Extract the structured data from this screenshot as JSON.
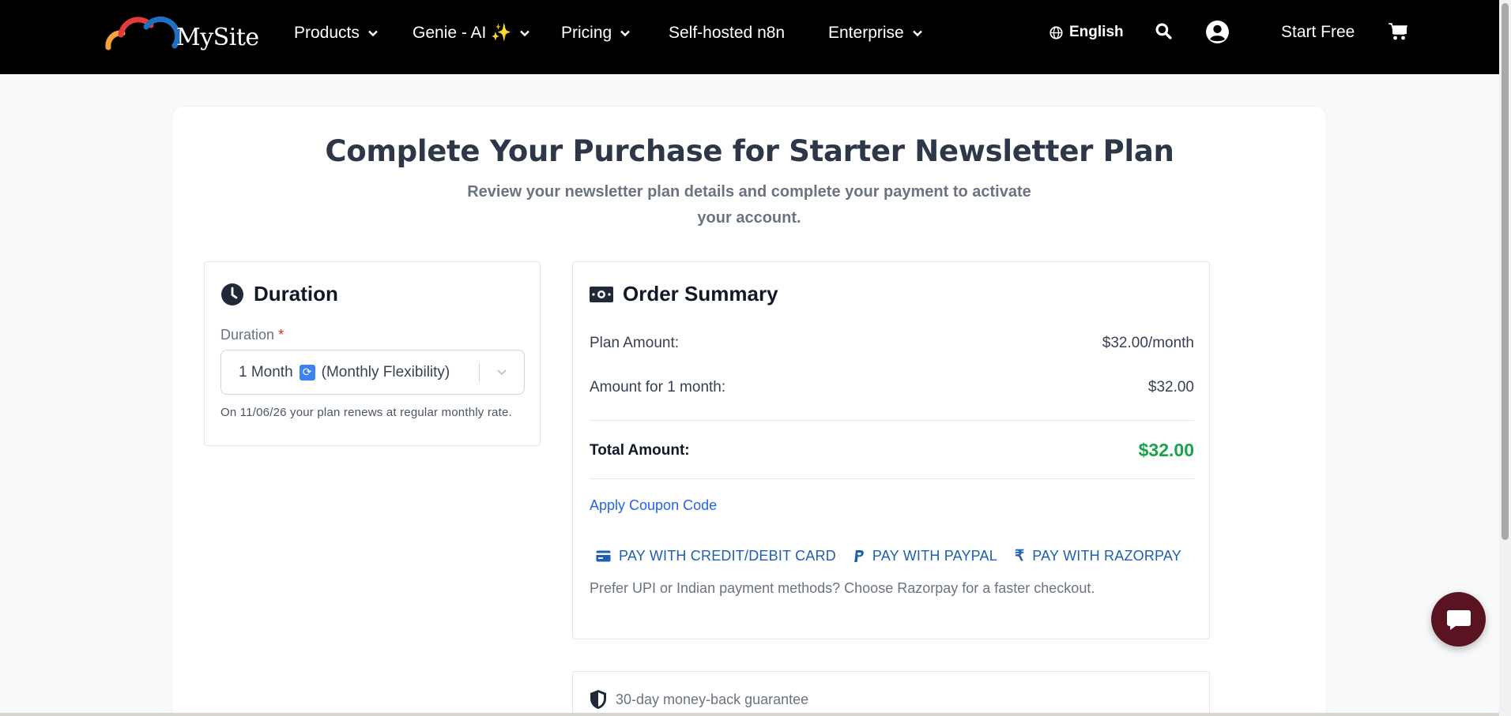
{
  "nav": {
    "logo_text": "MySite",
    "items": [
      {
        "label": "Products"
      },
      {
        "label": "Genie - AI ✨"
      },
      {
        "label": "Pricing"
      },
      {
        "label": "Self-hosted n8n"
      },
      {
        "label": "Enterprise"
      }
    ],
    "language": "English",
    "start_free": "Start Free",
    "icons": [
      "globe-icon",
      "search-icon",
      "user-icon",
      "cart-icon"
    ]
  },
  "page": {
    "title": "Complete Your Purchase for Starter Newsletter Plan",
    "subtitle": "Review your newsletter plan details and complete your payment to activate your account."
  },
  "duration": {
    "heading": "Duration",
    "field_label": "Duration",
    "required_mark": "*",
    "selected_value_prefix": "1 Month",
    "selected_value_emoji": "🔄",
    "selected_value_suffix": "(Monthly Flexibility)",
    "renew_note": "On 11/06/26 your plan renews at regular monthly rate."
  },
  "order": {
    "heading": "Order Summary",
    "plan_amount_label": "Plan Amount:",
    "plan_amount_value": "$32.00/month",
    "period_amount_label": "Amount for 1 month:",
    "period_amount_value": "$32.00",
    "total_label": "Total Amount:",
    "total_value": "$32.00",
    "coupon_label": "Apply Coupon Code",
    "pay_options": [
      {
        "label": "PAY WITH CREDIT/DEBIT CARD",
        "icon": "credit-card-icon"
      },
      {
        "label": "PAY WITH PAYPAL",
        "icon": "paypal-icon"
      },
      {
        "label": "PAY WITH RAZORPAY",
        "icon": "rupee-icon"
      }
    ],
    "pay_note": "Prefer UPI or Indian payment methods? Choose Razorpay for a faster checkout."
  },
  "guarantee": {
    "text": "30-day money-back guarantee"
  },
  "colors": {
    "nav_bg": "#000000",
    "accent_link": "#2563eb",
    "total_green": "#16a34a",
    "chat_bg": "#5a1320"
  }
}
